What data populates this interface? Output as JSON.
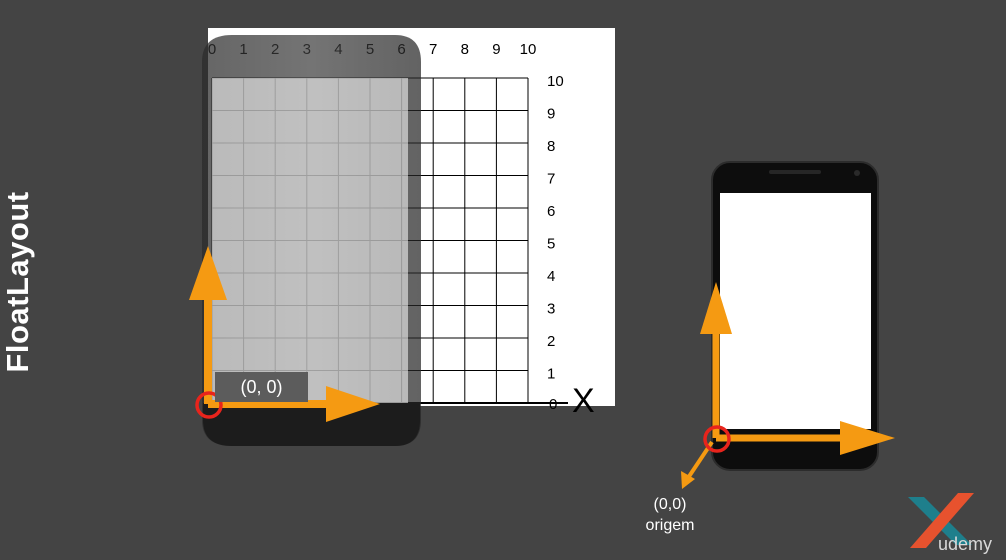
{
  "side_title": "FloatLayout",
  "grid": {
    "x_ticks": [
      "0",
      "1",
      "2",
      "3",
      "4",
      "5",
      "6",
      "7",
      "8",
      "9",
      "10"
    ],
    "y_ticks": [
      "1",
      "2",
      "3",
      "4",
      "5",
      "6",
      "7",
      "8",
      "9",
      "10"
    ],
    "y_zero": "0",
    "x_axis_letter": "X"
  },
  "left_phone": {
    "coord_label": "(0, 0)"
  },
  "right_phone": {
    "origin_coord": "(0,0)",
    "origin_caption": "origem"
  },
  "brand": {
    "name": "udemy",
    "colors": {
      "orange": "#e7522e",
      "teal": "#1e7f8c"
    }
  },
  "colors": {
    "background": "#444444",
    "arrow": "#f59a12",
    "origin_circle": "#e8241c"
  }
}
